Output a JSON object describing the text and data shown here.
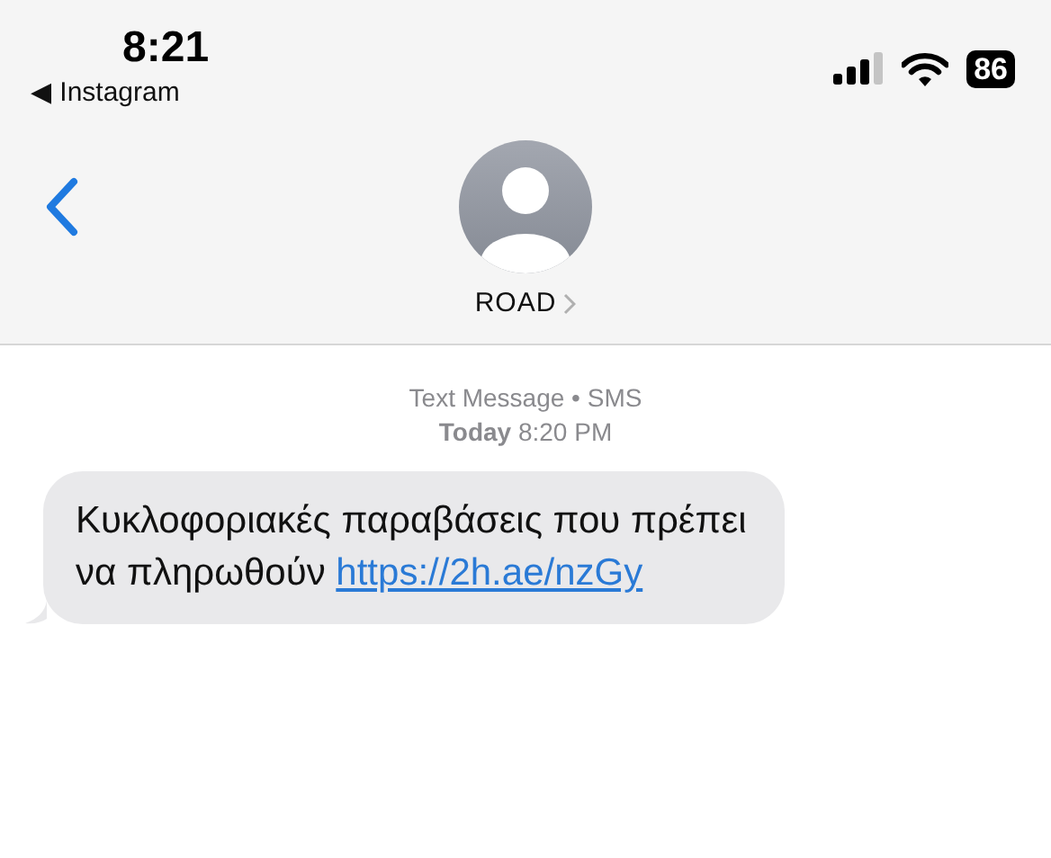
{
  "status_bar": {
    "time": "8:21",
    "back_app": "◀ Instagram",
    "battery": "86"
  },
  "header": {
    "contact": "ROAD"
  },
  "conversation": {
    "service": "Text Message • SMS",
    "timestamp_day": "Today",
    "timestamp_time": "8:20 PM",
    "messages": [
      {
        "kind": "incoming",
        "text": "Κυκλοφοριακές παραβάσεις που πρέπει να πληρωθούν",
        "link": "https://2h.ae/nzGy"
      }
    ]
  }
}
